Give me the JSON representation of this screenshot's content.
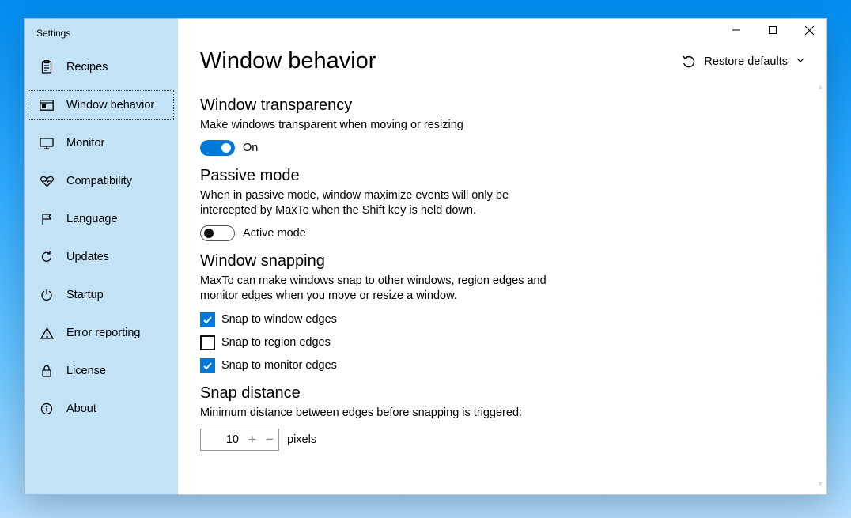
{
  "window": {
    "title": "Settings",
    "restore_defaults_label": "Restore defaults"
  },
  "sidebar": {
    "items": [
      {
        "label": "Recipes",
        "selected": false
      },
      {
        "label": "Window behavior",
        "selected": true
      },
      {
        "label": "Monitor",
        "selected": false
      },
      {
        "label": "Compatibility",
        "selected": false
      },
      {
        "label": "Language",
        "selected": false
      },
      {
        "label": "Updates",
        "selected": false
      },
      {
        "label": "Startup",
        "selected": false
      },
      {
        "label": "Error reporting",
        "selected": false
      },
      {
        "label": "License",
        "selected": false
      },
      {
        "label": "About",
        "selected": false
      }
    ]
  },
  "page": {
    "title": "Window behavior",
    "transparency": {
      "title": "Window transparency",
      "desc": "Make windows transparent when moving or resizing",
      "toggle_state": "on",
      "toggle_label": "On"
    },
    "passive": {
      "title": "Passive mode",
      "desc": "When in passive mode, window maximize events will only be intercepted by MaxTo when the Shift key is held down.",
      "toggle_state": "off",
      "toggle_label": "Active mode"
    },
    "snapping": {
      "title": "Window snapping",
      "desc": "MaxTo can make windows snap to other windows, region edges and monitor edges when you move or resize a window.",
      "checks": [
        {
          "label": "Snap to window edges",
          "checked": true
        },
        {
          "label": "Snap to region edges",
          "checked": false
        },
        {
          "label": "Snap to monitor edges",
          "checked": true
        }
      ]
    },
    "distance": {
      "title": "Snap distance",
      "desc": "Minimum distance between edges before snapping is triggered:",
      "value": "10",
      "unit_label": "pixels"
    }
  }
}
